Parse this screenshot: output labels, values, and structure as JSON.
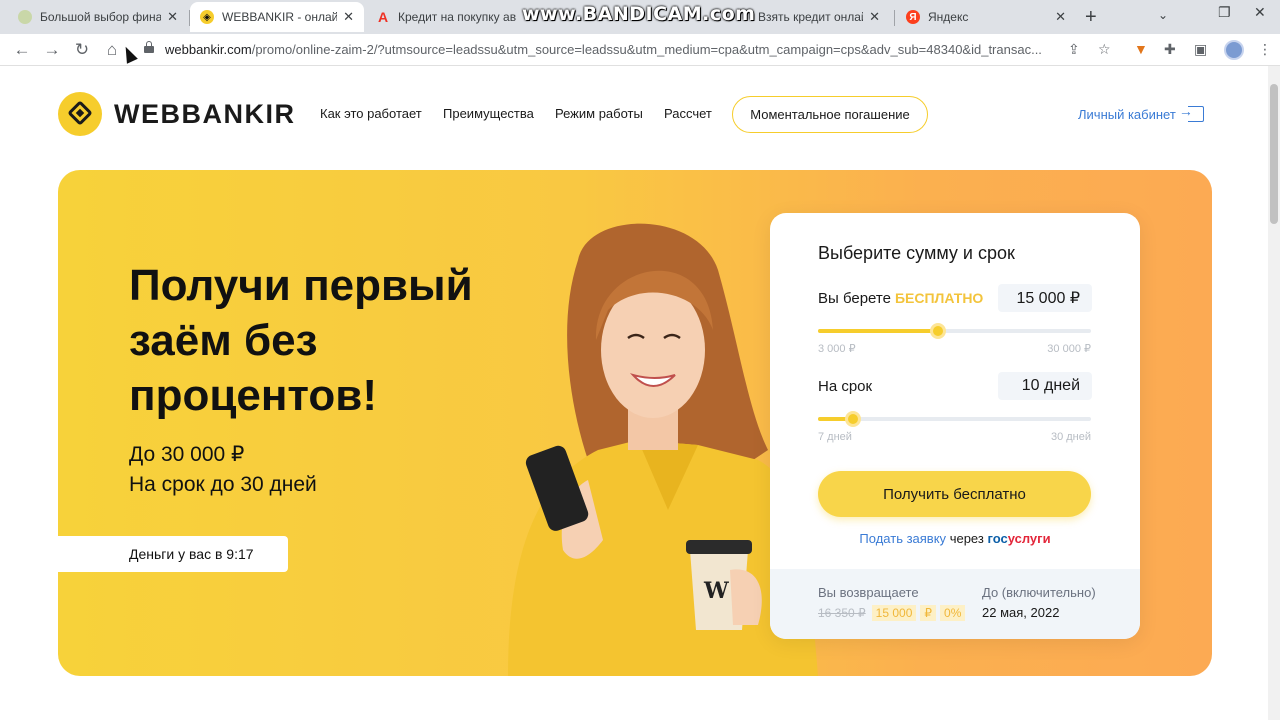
{
  "browser": {
    "tabs": [
      {
        "title": "Большой выбор фина",
        "active": false,
        "icon": "globe-icon"
      },
      {
        "title": "WEBBANKIR - онлайн з",
        "active": true,
        "icon": "webbankir-icon"
      },
      {
        "title": "Кредит на покупку авт",
        "active": false,
        "icon": "alfa-icon"
      },
      {
        "title": "Взять кредит онлайн",
        "active": false,
        "icon": "generic-icon"
      },
      {
        "title": "Яндекс",
        "active": false,
        "icon": "yandex-icon"
      }
    ],
    "watermark": "www.BANDICAM.com",
    "url_host": "webbankir.com",
    "url_path": "/promo/online-zaim-2/?utmsource=leadssu&utm_source=leadssu&utm_medium=cpa&utm_campaign=cps&adv_sub=48340&id_transac..."
  },
  "site": {
    "logo_text": "WEBBANKIR",
    "nav": [
      "Как это работает",
      "Преимущества",
      "Режим работы",
      "Рассчет"
    ],
    "repay_button": "Моментальное погашение",
    "cabinet_link": "Личный кабинет"
  },
  "hero": {
    "heading": "Получи первый заём без процентов!",
    "sub_line1": "До 30 000 ₽",
    "sub_line2": "На срок до 30 дней",
    "time_label": "Деньги у вас в 9:17"
  },
  "calculator": {
    "title": "Выберите сумму и срок",
    "amount_label": "Вы берете",
    "amount_free": "БЕСПЛАТНО",
    "amount_value": "15 000 ₽",
    "amount_min": "3 000 ₽",
    "amount_max": "30 000 ₽",
    "amount_fraction": 0.44,
    "term_label": "На срок",
    "term_value": "10 дней",
    "term_min": "7 дней",
    "term_max": "30 дней",
    "term_fraction": 0.13,
    "cta": "Получить бесплатно",
    "gos_prefix": "Подать заявку",
    "gos_mid": "через",
    "gos_brand1": "гос",
    "gos_brand2": "услуги",
    "return_label": "Вы возвращаете",
    "return_old": "16 350 ₽",
    "return_new": "15 000",
    "return_currency": "₽",
    "return_percent": "0%",
    "until_label": "До (включительно)",
    "until_date": "22 мая, 2022"
  },
  "colors": {
    "brand_yellow": "#f6cd2c",
    "link_blue": "#3a7bd5",
    "hero_orange": "#fcaa53"
  }
}
